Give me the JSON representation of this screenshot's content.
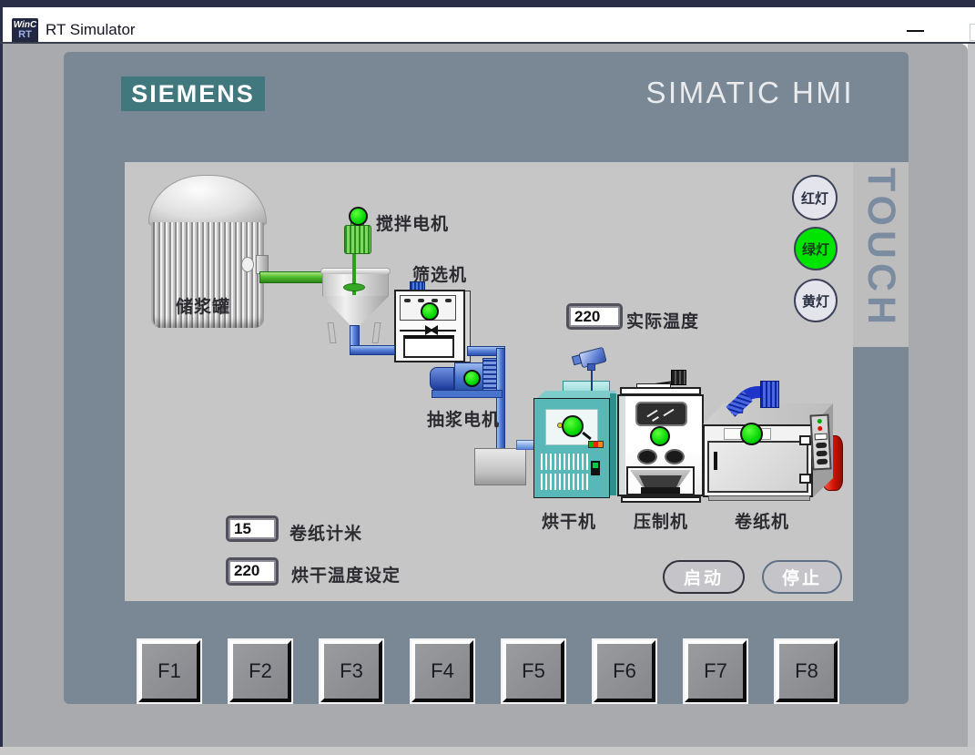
{
  "window": {
    "title": "RT Simulator",
    "icon": {
      "line1": "WinC",
      "line2": "RT"
    }
  },
  "panel": {
    "brand": "SIEMENS",
    "product": "SIMATIC HMI",
    "touch_label": "TOUCH"
  },
  "screen": {
    "labels": {
      "storage_tank": "储浆罐",
      "stir_motor": "搅拌电机",
      "screening_machine": "筛选机",
      "pump_motor": "抽浆电机",
      "dryer": "烘干机",
      "press": "压制机",
      "winder": "卷纸机"
    },
    "fields": {
      "actual_temp": {
        "value": "220",
        "label": "实际温度"
      },
      "paper_meter": {
        "value": "15",
        "label": "卷纸计米"
      },
      "dry_temp_set": {
        "value": "220",
        "label": "烘干温度设定"
      }
    },
    "lights": [
      {
        "label": "红灯",
        "state": "off"
      },
      {
        "label": "绿灯",
        "state": "on"
      },
      {
        "label": "黄灯",
        "state": "off"
      }
    ],
    "buttons": {
      "start": "启动",
      "stop": "停止"
    }
  },
  "function_keys": [
    "F1",
    "F2",
    "F3",
    "F4",
    "F5",
    "F6",
    "F7",
    "F8"
  ],
  "colors": {
    "title_accent": "#2A2F47",
    "frame": "#7A8795",
    "screen_bg": "#C6C6C6",
    "touch_strip": "#BDBDBD",
    "brand_teal": "#40787E",
    "indicator_on": "#00D400",
    "light_on": "#00E400",
    "light_off": "#E4E4EC",
    "pipe_green": "#54BC32",
    "pipe_blue": "#5B82D8",
    "dryer_teal": "#58B8B8",
    "alarm_red": "#CC1100"
  }
}
